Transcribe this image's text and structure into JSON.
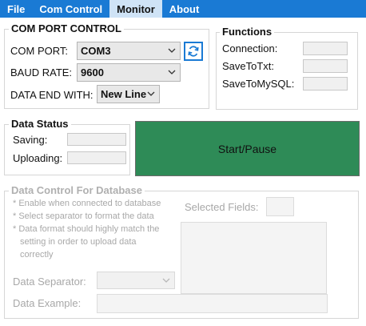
{
  "menu": {
    "file": "File",
    "com_control": "Com Control",
    "monitor": "Monitor",
    "about": "About"
  },
  "com_port_control": {
    "title": "COM PORT CONTROL",
    "com_port_label": "COM PORT:",
    "com_port_value": "COM3",
    "baud_rate_label": "BAUD RATE:",
    "baud_rate_value": "9600",
    "data_end_label": "DATA END WITH:",
    "data_end_value": "New Line"
  },
  "functions": {
    "title": "Functions",
    "connection_label": "Connection:",
    "save_txt_label": "SaveToTxt:",
    "save_mysql_label": "SaveToMySQL:"
  },
  "data_status": {
    "title": "Data Status",
    "saving_label": "Saving:",
    "uploading_label": "Uploading:"
  },
  "start_button": "Start/Pause",
  "data_control": {
    "title": "Data Control For Database",
    "notes": [
      "* Enable when connected to database",
      "* Select separator to format the data",
      "* Data format should highly match the",
      "setting in order to upload data",
      "correctly"
    ],
    "selected_fields_label": "Selected Fields:",
    "separator_label": "Data Separator:",
    "example_label": "Data Example:"
  },
  "colors": {
    "menubar": "#1a7ad4",
    "start_button": "#2e8b57"
  }
}
